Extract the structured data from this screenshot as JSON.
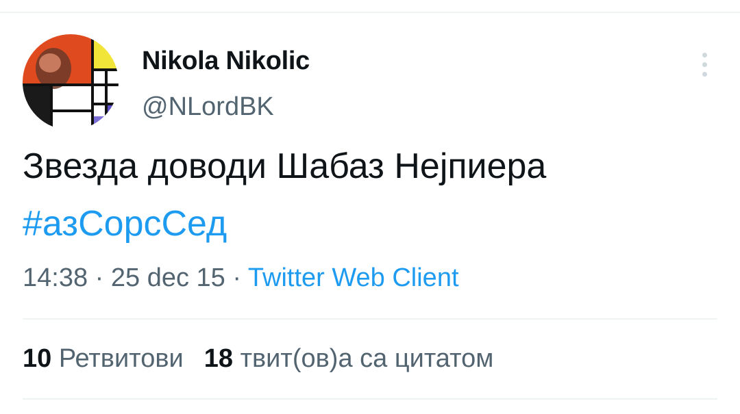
{
  "tweet": {
    "author": {
      "display_name": "Nikola Nikolic",
      "handle": "@NLordBK"
    },
    "text": "Звезда доводи Шабаз Нејпиера",
    "hashtag": "#азСорсСед",
    "time": "14:38",
    "date": "25 dec 15",
    "separator": "·",
    "source": "Twitter Web Client"
  },
  "stats": {
    "retweets_count": "10",
    "retweets_label": "Ретвитови",
    "quotes_count": "18",
    "quotes_label": "твит(ов)а са цитатом"
  },
  "colors": {
    "link": "#1d9bf0",
    "secondary_text": "#536471",
    "primary_text": "#0f1419",
    "divider": "#eff3f4"
  },
  "icons": {
    "more": "more-vertical-icon"
  }
}
